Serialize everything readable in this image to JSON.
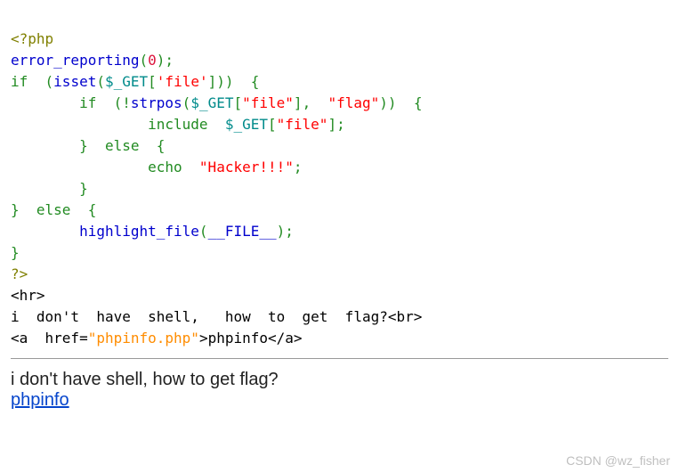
{
  "code": {
    "open_tag": "<?php",
    "err_fn": "error_reporting",
    "err_arg": "0",
    "kw_if": "if",
    "kw_else": "else",
    "fn_isset": "isset",
    "var_get": "$_GET",
    "key_file_s": "'file'",
    "key_file_d": "\"file\"",
    "str_flag": "\"flag\"",
    "fn_strpos": "strpos",
    "kw_include": "include",
    "kw_echo": "echo",
    "str_hacker": "\"Hacker!!!\"",
    "fn_highlight": "highlight_file",
    "const_file": "__FILE__",
    "close_tag": "?>",
    "tag_hr": "<hr>",
    "plain_line": "i  don't  have  shell,   how  to  get  flag?",
    "tag_br": "<br>",
    "tag_a_open1": "<a  href=",
    "href_val": "\"phpinfo.php\"",
    "tag_a_open2": ">",
    "a_text": "phpinfo",
    "tag_a_close": "</a>",
    "p_open": "(",
    "p_close": ")",
    "b_open": "[",
    "b_close": "]",
    "c_open": "{",
    "c_close": "}",
    "semi": ";",
    "comma": ",",
    "bang": "!"
  },
  "rendered": {
    "question": "i don't have shell, how to get flag?",
    "link_text": "phpinfo",
    "link_href": "phpinfo.php"
  },
  "watermark": "CSDN @wz_fisher"
}
